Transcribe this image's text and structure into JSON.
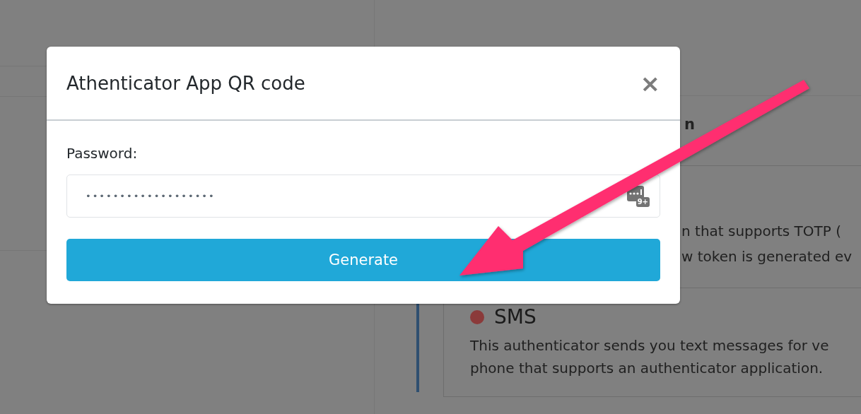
{
  "background_page": {
    "heading_fragment": "n",
    "totp_lines": [
      "n that supports TOTP (",
      "w token is generated ev"
    ],
    "sms": {
      "title": "SMS",
      "color": "#8b3a3a",
      "lines": [
        "This authenticator sends you text messages for ve",
        "phone that supports an authenticator application."
      ]
    }
  },
  "modal": {
    "title": "Athenticator App QR code",
    "close": "×",
    "label": "Password:",
    "value": "•••••••••••••••••••",
    "field_badge": "9+",
    "button": "Generate"
  }
}
